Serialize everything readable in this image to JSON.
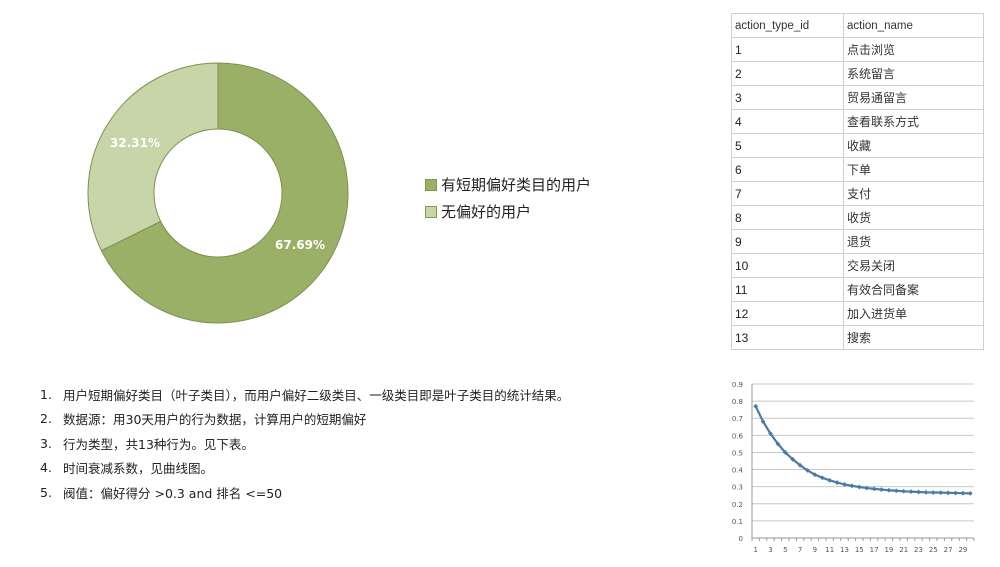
{
  "chart_data": [
    {
      "type": "pie",
      "variant": "donut",
      "labels": [
        "有短期偏好类目的用户",
        "无偏好的用户"
      ],
      "values": [
        67.69,
        32.31
      ],
      "data_labels": [
        "67.69%",
        "32.31%"
      ],
      "colors": [
        "#9bb067",
        "#c7d5a8"
      ],
      "legend": "right"
    },
    {
      "type": "line",
      "title": "",
      "xlabel": "",
      "ylabel": "",
      "x": [
        1,
        2,
        3,
        4,
        5,
        6,
        7,
        8,
        9,
        10,
        11,
        12,
        13,
        14,
        15,
        16,
        17,
        18,
        19,
        20,
        21,
        22,
        23,
        24,
        25,
        26,
        27,
        28,
        29,
        30
      ],
      "series": [
        {
          "name": "时间衰减系数",
          "values": [
            0.77,
            0.68,
            0.61,
            0.55,
            0.5,
            0.46,
            0.425,
            0.395,
            0.37,
            0.352,
            0.337,
            0.324,
            0.313,
            0.305,
            0.298,
            0.292,
            0.287,
            0.283,
            0.279,
            0.276,
            0.273,
            0.271,
            0.269,
            0.267,
            0.266,
            0.265,
            0.264,
            0.263,
            0.262,
            0.261
          ],
          "color": "#4a7aa8"
        }
      ],
      "xticks": [
        "1",
        "3",
        "5",
        "7",
        "9",
        "11",
        "13",
        "15",
        "17",
        "19",
        "21",
        "23",
        "25",
        "27",
        "29"
      ],
      "yticks": [
        "0",
        "0.1",
        "0.2",
        "0.3",
        "0.4",
        "0.5",
        "0.6",
        "0.7",
        "0.8",
        "0.9"
      ],
      "ylim": [
        0,
        0.9
      ],
      "grid": true
    }
  ],
  "notes": [
    {
      "num": "1.",
      "text": "用户短期偏好类目（叶子类目），而用户偏好二级类目、一级类目即是叶子类目的统计结果。"
    },
    {
      "num": "2.",
      "text": "数据源：用30天用户的行为数据，计算用户的短期偏好"
    },
    {
      "num": "3.",
      "text": "行为类型，共13种行为。见下表。"
    },
    {
      "num": "4.",
      "text": "时间衰减系数，见曲线图。"
    },
    {
      "num": "5.",
      "text": "阀值：偏好得分 >0.3 and 排名 <=50"
    }
  ],
  "table": {
    "headers": [
      "action_type_id",
      "action_name"
    ],
    "rows": [
      [
        "1",
        "点击浏览"
      ],
      [
        "2",
        "系统留言"
      ],
      [
        "3",
        "贸易通留言"
      ],
      [
        "4",
        "查看联系方式"
      ],
      [
        "5",
        "收藏"
      ],
      [
        "6",
        "下单"
      ],
      [
        "7",
        "支付"
      ],
      [
        "8",
        "收货"
      ],
      [
        "9",
        "退货"
      ],
      [
        "10",
        "交易关闭"
      ],
      [
        "11",
        "有效合同备案"
      ],
      [
        "12",
        "加入进货单"
      ],
      [
        "13",
        "搜索"
      ]
    ]
  }
}
